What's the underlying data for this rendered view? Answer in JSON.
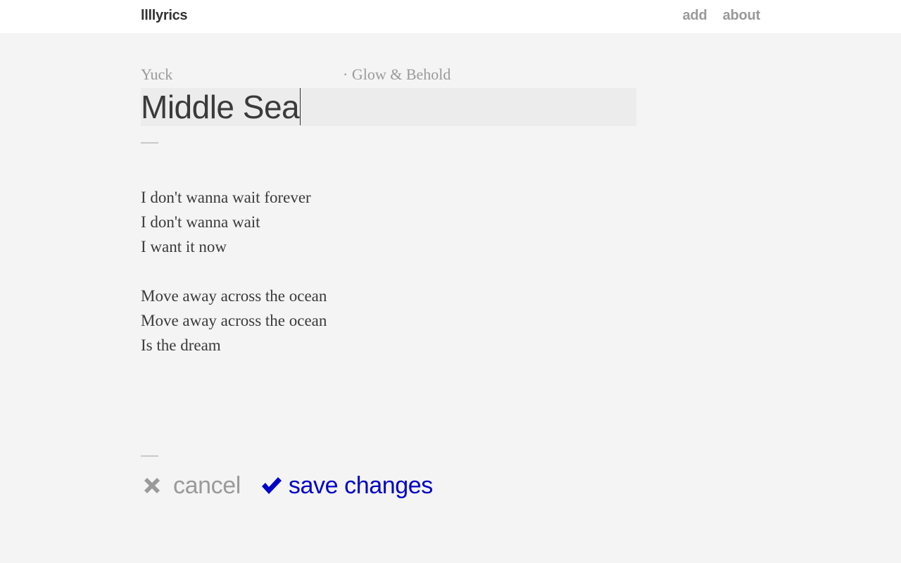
{
  "header": {
    "logo": "llllyrics",
    "nav": [
      {
        "label": "add"
      },
      {
        "label": "about"
      }
    ]
  },
  "song": {
    "artist": "Yuck",
    "album": "· Glow & Behold",
    "title": "Middle Sea",
    "lyrics": [
      "I don't wanna wait forever",
      "I don't wanna wait",
      "I want it now",
      "",
      "Move away across the ocean",
      "Move away across the ocean",
      "Is the dream"
    ]
  },
  "actions": {
    "cancel_label": "cancel",
    "save_label": "save changes",
    "cancel_icon": "x-icon",
    "save_icon": "checkmark-icon"
  },
  "colors": {
    "background": "#f4f4f4",
    "header": "#ffffff",
    "text": "#3a3a3a",
    "muted": "#9a9a9a",
    "accent": "#0000c8"
  }
}
